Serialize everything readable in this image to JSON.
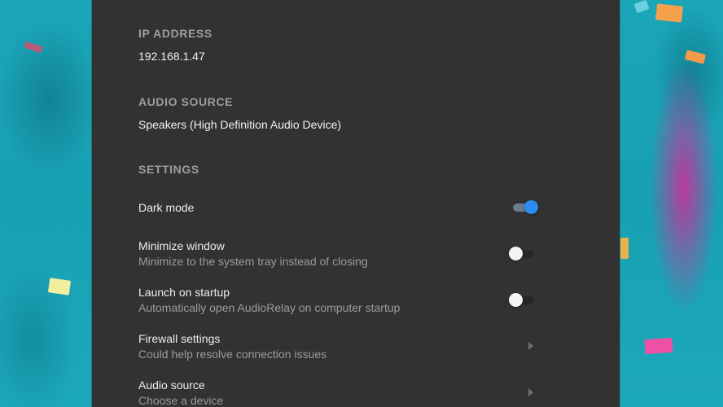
{
  "ip_address": {
    "header": "IP ADDRESS",
    "value": "192.168.1.47"
  },
  "audio_source": {
    "header": "AUDIO SOURCE",
    "value": "Speakers (High Definition Audio Device)"
  },
  "settings": {
    "header": "SETTINGS",
    "items": [
      {
        "title": "Dark mode",
        "subtitle": "",
        "control": "toggle",
        "enabled": true
      },
      {
        "title": "Minimize window",
        "subtitle": "Minimize to the system tray instead of closing",
        "control": "toggle",
        "enabled": false
      },
      {
        "title": "Launch on startup",
        "subtitle": "Automatically open AudioRelay on computer startup",
        "control": "toggle",
        "enabled": false
      },
      {
        "title": "Firewall settings",
        "subtitle": "Could help resolve connection issues",
        "control": "chevron-right-icon"
      },
      {
        "title": "Audio source",
        "subtitle": "Choose a device",
        "control": "chevron-right-icon"
      }
    ]
  },
  "colors": {
    "panel_background": "#323232",
    "accent": "#2e8cf0",
    "header_text": "#9e9e9e",
    "primary_text": "#ededed",
    "secondary_text": "#9b9b9b",
    "desktop_background": "#1fa3b5"
  }
}
